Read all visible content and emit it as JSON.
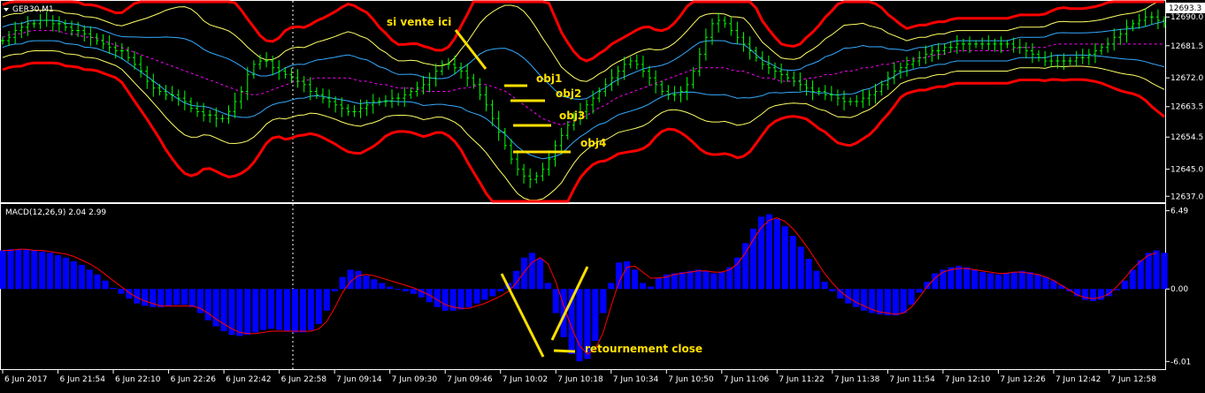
{
  "price_panel": {
    "symbol_label": "GER30,M1",
    "current_price_label": "12693.3",
    "price_ticks": [
      "12690.0",
      "12681.5",
      "12672.0",
      "12663.5",
      "12654.5",
      "12645.0",
      "12637.0"
    ],
    "annotations": [
      {
        "text": "si vente ici",
        "color": "#ffe000"
      },
      {
        "text": "obj1",
        "color": "#ffe000"
      },
      {
        "text": "obj2",
        "color": "#ffe000"
      },
      {
        "text": "obj3",
        "color": "#ffe000"
      },
      {
        "text": "obj4",
        "color": "#ffe000"
      }
    ]
  },
  "macd_panel": {
    "label": "MACD(12,26,9) 2.04 2.99",
    "ticks": [
      "6.49",
      "0.00",
      "-6.01"
    ],
    "annotation": "retournement close"
  },
  "time_axis": {
    "labels": [
      "6 Jun 2017",
      "6 Jun 21:54",
      "6 Jun 22:10",
      "6 Jun 22:26",
      "6 Jun 22:42",
      "6 Jun 22:58",
      "7 Jun 09:14",
      "7 Jun 09:30",
      "7 Jun 09:46",
      "7 Jun 10:02",
      "7 Jun 10:18",
      "7 Jun 10:34",
      "7 Jun 10:50",
      "7 Jun 11:06",
      "7 Jun 11:22",
      "7 Jun 11:38",
      "7 Jun 11:54",
      "7 Jun 12:10",
      "7 Jun 12:26",
      "7 Jun 12:42",
      "7 Jun 12:58"
    ]
  },
  "colors": {
    "background": "#000000",
    "grid_text": "#ffffff",
    "candles": "#00ff00",
    "outer_band": "#ff0000",
    "middle_band": "#ffff66",
    "inner_band": "#33aaff",
    "mid_line": "#ff00ff",
    "macd_hist": "#0000ff",
    "macd_signal": "#ff0000",
    "annotation": "#ffe000"
  },
  "chart_data": [
    {
      "type": "line",
      "title": "GER30,M1",
      "yticks": [
        12690.0,
        12681.5,
        12672.0,
        12663.5,
        12654.5,
        12645.0,
        12637.0
      ],
      "ylim": [
        12635.5,
        12694.5
      ],
      "series": [
        {
          "values": [
            12683,
            12684,
            12686,
            12687,
            12688,
            12688,
            12689,
            12689,
            12688,
            12688,
            12687,
            12686,
            12686,
            12685,
            12684,
            12683,
            12682,
            12681,
            12680,
            12680,
            12678,
            12676,
            12674,
            12671,
            12669,
            12668,
            12667,
            12667,
            12666,
            12665,
            12663,
            12662,
            12661,
            12661,
            12660,
            12660,
            12662,
            12665,
            12668,
            12673,
            12676,
            12677,
            12677,
            12675,
            12674,
            12673,
            12672,
            12671,
            12670,
            12668,
            12667,
            12666,
            12665,
            12664,
            12663,
            12662,
            12662,
            12663,
            12664,
            12665,
            12665,
            12665,
            12666,
            12666,
            12667,
            12668,
            12669,
            12670,
            12672,
            12674,
            12676,
            12676,
            12675,
            12674,
            12672,
            12670,
            12667,
            12664,
            12660,
            12656,
            12652,
            12648,
            12645,
            12643,
            12642,
            12643,
            12645,
            12648,
            12652,
            12655,
            12658,
            12660,
            12662,
            12664,
            12666,
            12668,
            12670,
            12672,
            12674,
            12676,
            12677,
            12676,
            12674,
            12672,
            12670,
            12668,
            12667,
            12667,
            12668,
            12670,
            12674,
            12679,
            12684,
            12688,
            12689,
            12688,
            12686,
            12684,
            12682,
            12680,
            12678,
            12676,
            12675,
            12674,
            12673,
            12672,
            12671,
            12670,
            12669,
            12668,
            12668,
            12667,
            12667,
            12666,
            12665,
            12665,
            12665,
            12666,
            12667,
            12668,
            12670,
            12672,
            12674,
            12675,
            12676,
            12677,
            12678,
            12679,
            12680,
            12680,
            12681,
            12681,
            12682,
            12682,
            12682,
            12682,
            12682,
            12682,
            12682,
            12682,
            12682,
            12681,
            12681,
            12680,
            12679,
            12678,
            12677,
            12677,
            12677,
            12677,
            12677,
            12678,
            12678,
            12679,
            12680,
            12681,
            12682,
            12684,
            12685,
            12687,
            12688,
            12689,
            12690,
            12690,
            12689,
            12688
          ]
        },
        {
          "values": [
            12684,
            12685,
            12685,
            12686,
            12686,
            12686,
            12686,
            12685,
            12685,
            12684,
            12684,
            12683,
            12682,
            12681,
            12680,
            12679,
            12678,
            12677,
            12676,
            12675,
            12674,
            12673,
            12672,
            12671,
            12670,
            12669,
            12668,
            12667,
            12667,
            12668,
            12669,
            12670,
            12671,
            12671,
            12672,
            12672,
            12672,
            12672,
            12672,
            12671,
            12671,
            12670,
            12670,
            12669,
            12669,
            12669,
            12668,
            12668,
            12668,
            12668,
            12669,
            12669,
            12670,
            12670,
            12669,
            12668,
            12666,
            12664,
            12662,
            12660,
            12659,
            12658,
            12659,
            12660,
            12661,
            12663,
            12664,
            12666,
            12667,
            12668,
            12669,
            12670,
            12671,
            12672,
            12673,
            12674,
            12675,
            12675,
            12675,
            12675,
            12674,
            12674,
            12673,
            12672,
            12672,
            12671,
            12671,
            12671,
            12672,
            12672,
            12673,
            12673,
            12674,
            12674,
            12675,
            12675,
            12676,
            12676,
            12677,
            12677,
            12678,
            12678,
            12679,
            12679,
            12680,
            12680,
            12680,
            12680,
            12680,
            12680,
            12680,
            12681,
            12681,
            12681,
            12681,
            12682,
            12682,
            12682,
            12682,
            12682,
            12682,
            12682,
            12682,
            12682,
            12682,
            12682,
            12682,
            12682
          ]
        }
      ]
    },
    {
      "type": "bar",
      "title": "MACD(12,26,9) 2.04 2.99",
      "yticks": [
        6.49,
        0.0,
        -6.01
      ],
      "ylim": [
        -6.5,
        6.9
      ],
      "series": [
        {
          "name": "MACD",
          "values": [
            3.2,
            3.3,
            3.3,
            3.3,
            3.2,
            3.1,
            3.0,
            2.8,
            2.6,
            2.3,
            2.0,
            1.6,
            1.2,
            0.7,
            0.1,
            -0.4,
            -0.8,
            -1.2,
            -1.4,
            -1.5,
            -1.5,
            -1.4,
            -1.3,
            -1.3,
            -1.5,
            -2.0,
            -2.6,
            -3.1,
            -3.5,
            -3.8,
            -3.9,
            -3.8,
            -3.6,
            -3.4,
            -3.3,
            -3.4,
            -3.5,
            -3.6,
            -3.6,
            -3.4,
            -2.9,
            -1.8,
            -0.2,
            1.0,
            1.6,
            1.5,
            1.1,
            0.8,
            0.5,
            0.2,
            0.0,
            -0.2,
            -0.4,
            -0.7,
            -1.1,
            -1.5,
            -1.8,
            -1.8,
            -1.7,
            -1.5,
            -1.2,
            -0.9,
            -0.6,
            -0.2,
            0.5,
            1.5,
            2.6,
            3.0,
            2.5,
            0.5,
            -2.0,
            -4.0,
            -5.4,
            -6.0,
            -5.8,
            -4.3,
            -2.0,
            0.5,
            2.2,
            2.3,
            1.6,
            0.5,
            0.2,
            0.9,
            1.2,
            1.3,
            1.4,
            1.5,
            1.6,
            1.5,
            1.3,
            1.4,
            1.8,
            2.6,
            3.8,
            5.0,
            6.0,
            6.2,
            5.8,
            5.2,
            4.4,
            3.5,
            2.5,
            1.5,
            0.6,
            -0.2,
            -0.8,
            -1.2,
            -1.5,
            -1.8,
            -2.0,
            -2.1,
            -2.2,
            -2.2,
            -2.0,
            -1.3,
            -0.3,
            0.6,
            1.3,
            1.6,
            1.8,
            1.9,
            1.8,
            1.6,
            1.4,
            1.3,
            1.2,
            1.3,
            1.4,
            1.5,
            1.4,
            1.2,
            1.0,
            0.7,
            0.3,
            -0.2,
            -0.6,
            -0.9,
            -1.0,
            -0.9,
            -0.6,
            -0.1,
            0.7,
            1.6,
            2.4,
            3.0,
            3.2,
            3.0
          ]
        },
        {
          "name": "Signal",
          "values": [
            3.2,
            3.2,
            3.3,
            3.3,
            3.2,
            3.2,
            3.1,
            3.0,
            2.9,
            2.7,
            2.4,
            2.1,
            1.7,
            1.2,
            0.7,
            0.2,
            -0.3,
            -0.7,
            -1.0,
            -1.2,
            -1.4,
            -1.4,
            -1.4,
            -1.4,
            -1.4,
            -1.6,
            -2.0,
            -2.5,
            -2.9,
            -3.3,
            -3.6,
            -3.7,
            -3.7,
            -3.6,
            -3.5,
            -3.5,
            -3.5,
            -3.5,
            -3.5,
            -3.5,
            -3.3,
            -2.7,
            -1.6,
            -0.3,
            0.6,
            1.1,
            1.2,
            1.1,
            0.9,
            0.7,
            0.5,
            0.3,
            0.1,
            -0.2,
            -0.5,
            -0.9,
            -1.3,
            -1.5,
            -1.6,
            -1.6,
            -1.4,
            -1.2,
            -0.9,
            -0.6,
            -0.2,
            0.5,
            1.4,
            2.2,
            2.6,
            2.1,
            0.6,
            -1.4,
            -3.2,
            -4.7,
            -5.4,
            -5.0,
            -3.6,
            -1.4,
            0.6,
            1.8,
            1.9,
            1.4,
            0.9,
            0.9,
            1.0,
            1.2,
            1.3,
            1.4,
            1.5,
            1.5,
            1.4,
            1.4,
            1.6,
            2.1,
            3.0,
            4.1,
            5.1,
            5.7,
            5.9,
            5.6,
            5.0,
            4.2,
            3.3,
            2.3,
            1.3,
            0.5,
            -0.2,
            -0.7,
            -1.1,
            -1.4,
            -1.7,
            -1.9,
            -2.0,
            -2.1,
            -2.0,
            -1.5,
            -0.7,
            0.2,
            0.9,
            1.4,
            1.6,
            1.7,
            1.7,
            1.6,
            1.5,
            1.4,
            1.3,
            1.3,
            1.4,
            1.4,
            1.3,
            1.2,
            1.0,
            0.7,
            0.3,
            -0.1,
            -0.5,
            -0.7,
            -0.8,
            -0.7,
            -0.4,
            0.2,
            0.9,
            1.7,
            2.3,
            2.8,
            3.0
          ]
        }
      ]
    }
  ]
}
